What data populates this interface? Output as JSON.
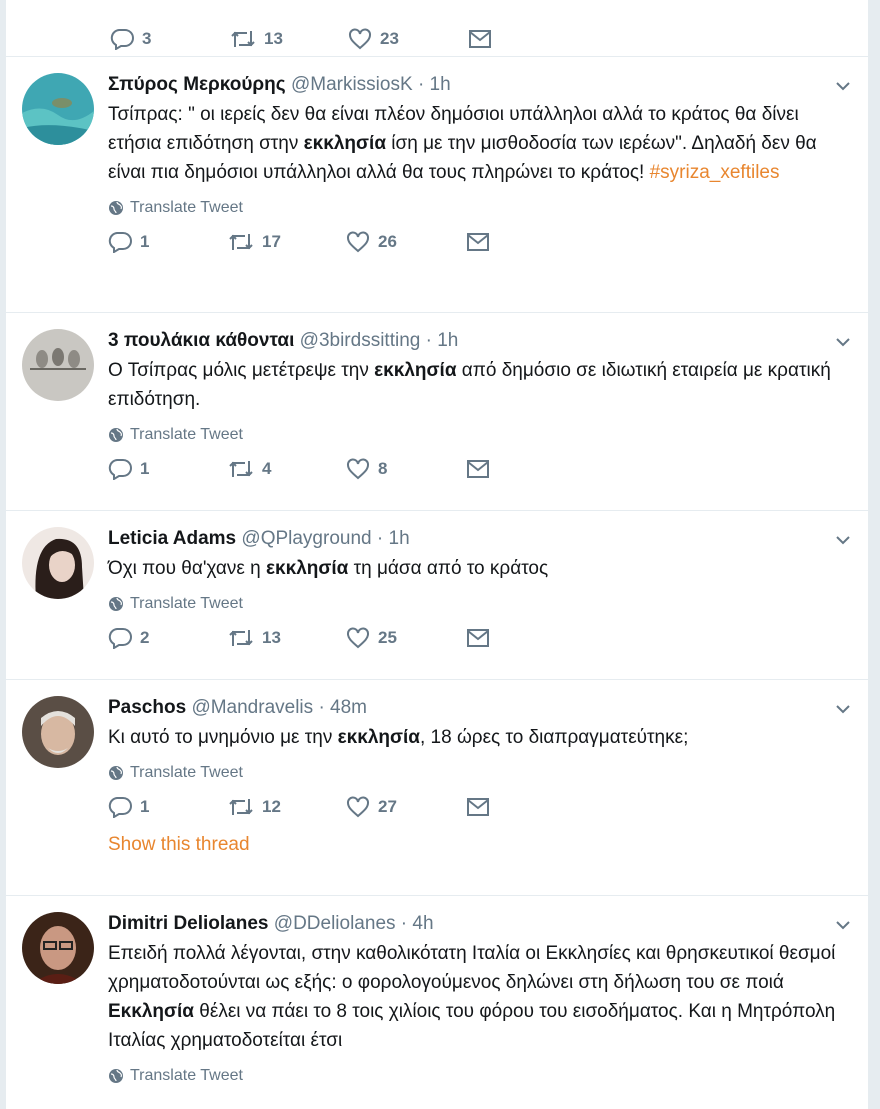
{
  "first_actions": {
    "replies": "3",
    "retweets": "13",
    "likes": "23"
  },
  "translate_label": "Translate Tweet",
  "show_thread_label": "Show this thread",
  "tweets": [
    {
      "name": "Σπύρος Μερκούρης",
      "handle": "@MarkissiosK",
      "sep": "·",
      "time": "1h",
      "text_parts": [
        "Τσίπρας: \" οι ιερείς δεν θα είναι πλέον δημόσιοι υπάλληλοι αλλά το κράτος θα δίνει ετήσια επιδότηση στην ",
        "εκκλησία",
        " ίση με την μισθοδοσία των ιερέων\". Δηλαδή δεν θα είναι πια δημόσιοι υπάλληλοι αλλά θα τους πληρώνει το κράτος! "
      ],
      "hashtag": "#syriza_xeftiles",
      "replies": "1",
      "retweets": "17",
      "likes": "26"
    },
    {
      "name": "3 πουλάκια κάθονται",
      "handle": "@3birdssitting",
      "sep": "·",
      "time": "1h",
      "text_parts": [
        "Ο Τσίπρας μόλις μετέτρεψε την ",
        "εκκλησία",
        " από δημόσιο σε ιδιωτική εταιρεία με κρατική επιδότηση."
      ],
      "replies": "1",
      "retweets": "4",
      "likes": "8"
    },
    {
      "name": "Leticia Adams",
      "handle": "@QPlayground",
      "sep": "·",
      "time": "1h",
      "text_parts": [
        "Όχι που θα'χανε η ",
        "εκκλησία",
        " τη μάσα από το κράτος"
      ],
      "replies": "2",
      "retweets": "13",
      "likes": "25"
    },
    {
      "name": "Paschos",
      "handle": "@Mandravelis",
      "sep": "·",
      "time": "48m",
      "text_parts": [
        "Κι αυτό το μνημόνιο με την ",
        "εκκλησία",
        ", 18 ώρες το διαπραγματεύτηκε;"
      ],
      "replies": "1",
      "retweets": "12",
      "likes": "27"
    },
    {
      "name": "Dimitri Deliolanes",
      "handle": "@DDeliolanes",
      "sep": "·",
      "time": "4h",
      "text_parts": [
        "Επειδή πολλά λέγονται, στην καθολικότατη Ιταλία οι Εκκλησίες και θρησκευτικοί θεσμοί χρηματοδοτούνται ως εξής: ο φορολογούμενος δηλώνει στη δήλωση του σε ποιά ",
        "Εκκλησία",
        " θέλει να πάει το 8 τοις χιλίοις του φόρου του εισοδήματος. Και η Μητρόπολη Ιταλίας χρηματοδοτείται έτσι"
      ]
    }
  ],
  "colors": {
    "accent": "#e8862f",
    "muted": "#657786",
    "divider": "#e6ecf0"
  }
}
